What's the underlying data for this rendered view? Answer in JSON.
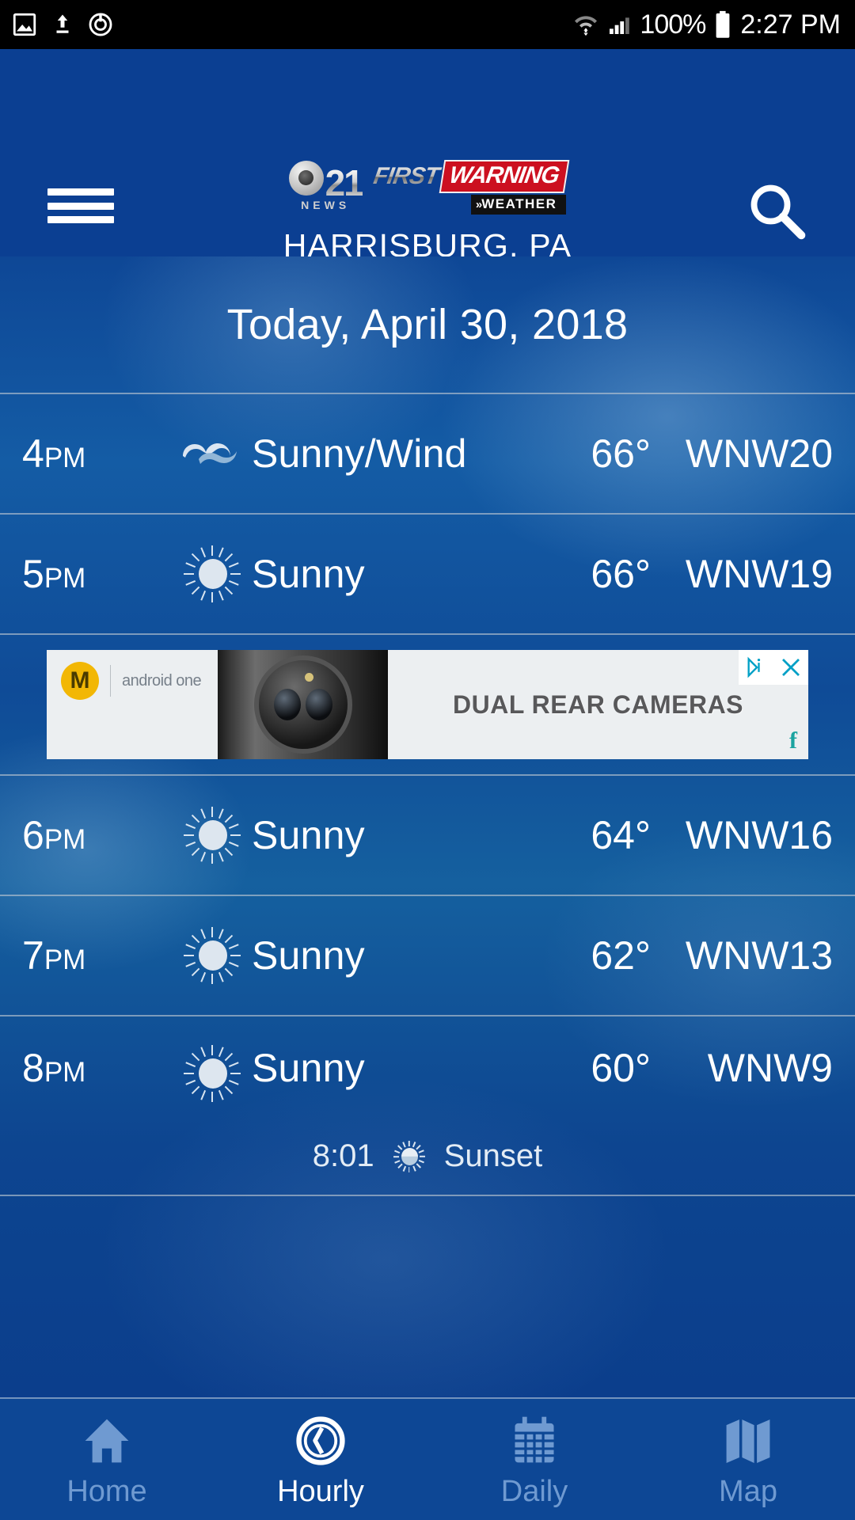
{
  "statusbar": {
    "icons": [
      "image-icon",
      "upload-icon",
      "alarm-icon",
      "wifi-icon",
      "signal-icon"
    ],
    "battery_percent": "100%",
    "clock": "2:27 PM"
  },
  "header": {
    "menu_icon": "hamburger-menu-icon",
    "search_icon": "search-icon",
    "logo": {
      "channel_number": "21",
      "news_word": "NEWS",
      "first": "FIRST",
      "warning": "WARNING",
      "weather": "WEATHER",
      "chevrons": "»"
    },
    "location": "HARRISBURG, PA",
    "background_color": "#0b3f92"
  },
  "main": {
    "date_heading": "Today, April 30, 2018",
    "hours": [
      {
        "time": "4",
        "ampm": "PM",
        "icon": "wind-icon",
        "condition": "Sunny/Wind",
        "temp": "66°",
        "wind": "WNW20"
      },
      {
        "time": "5",
        "ampm": "PM",
        "icon": "sun-icon",
        "condition": "Sunny",
        "temp": "66°",
        "wind": "WNW19"
      },
      {
        "time": "6",
        "ampm": "PM",
        "icon": "sun-icon",
        "condition": "Sunny",
        "temp": "64°",
        "wind": "WNW16"
      },
      {
        "time": "7",
        "ampm": "PM",
        "icon": "sun-icon",
        "condition": "Sunny",
        "temp": "62°",
        "wind": "WNW13"
      },
      {
        "time": "8",
        "ampm": "PM",
        "icon": "sun-icon",
        "condition": "Sunny",
        "temp": "60°",
        "wind": "WNW9",
        "event": {
          "time": "8:01",
          "icon": "sunset-icon",
          "label": "Sunset"
        }
      }
    ]
  },
  "ad": {
    "brand": "Motorola",
    "brand_mark": "M",
    "sub_brand": "android one",
    "headline": "DUAL REAR CAMERAS",
    "adchoices_icon": "adchoices-icon",
    "close_icon": "close-icon",
    "flurry_mark": "f"
  },
  "bottom_nav": {
    "items": [
      {
        "label": "Home",
        "icon": "home-icon",
        "active": false
      },
      {
        "label": "Hourly",
        "icon": "clock-icon",
        "active": true
      },
      {
        "label": "Daily",
        "icon": "calendar-icon",
        "active": false
      },
      {
        "label": "Map",
        "icon": "map-icon",
        "active": false
      }
    ]
  },
  "colors": {
    "brand_blue": "#0b3f92",
    "sky_blue": "#15609f",
    "nav_inactive": "#6f9ad1",
    "accent_red": "#cc1020"
  }
}
